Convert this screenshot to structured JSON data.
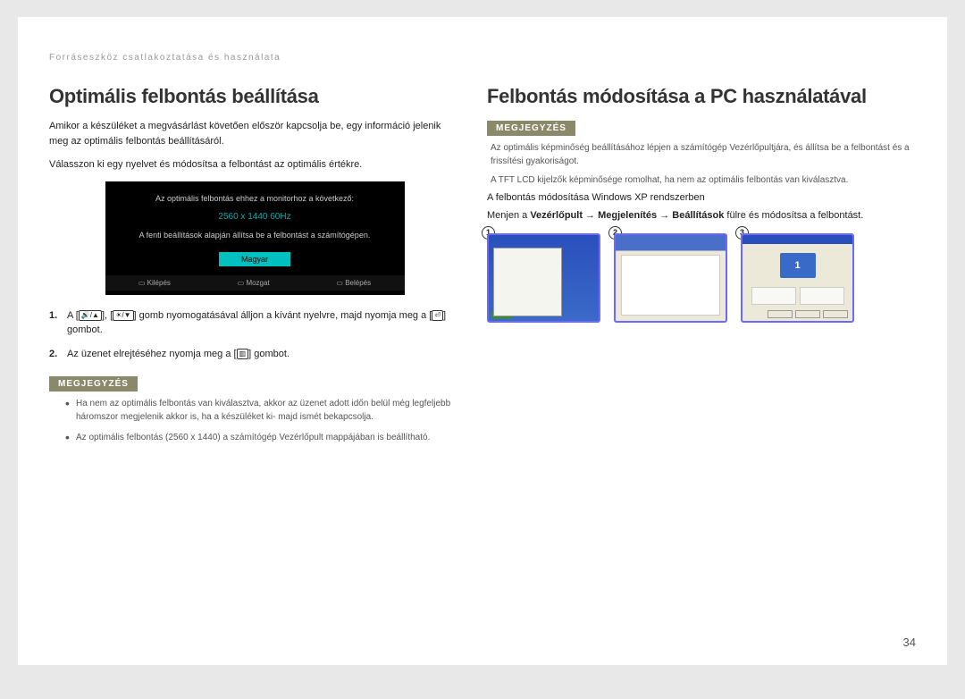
{
  "header": {
    "breadcrumb": "Forráseszköz csatlakoztatása és használata"
  },
  "left": {
    "heading": "Optimális felbontás beállítása",
    "p1": "Amikor a készüléket a megvásárlást követően először kapcsolja be, egy információ jelenik meg az optimális felbontás beállításáról.",
    "p2": "Válasszon ki egy nyelvet és módosítsa a felbontást az optimális értékre.",
    "osd": {
      "line1": "Az optimális felbontás ehhez a monitorhoz a következő:",
      "resolution": "2560 x 1440 60Hz",
      "line2": "A fenti beállítások alapján állítsa be a felbontást a számítógépen.",
      "lang": "Magyar",
      "btn_exit": "Kilépés",
      "btn_move": "Mozgat",
      "btn_enter": "Belépés"
    },
    "step1_a": "A [",
    "step1_b": "], [",
    "step1_c": "] gomb nyomogatásával álljon a kívánt nyelvre, majd nyomja meg a [",
    "step1_d": "] gombot.",
    "step2_a": "Az üzenet elrejtéséhez nyomja meg a [",
    "step2_b": "] gombot.",
    "note_label": "MEGJEGYZÉS",
    "note1": "Ha nem az optimális felbontás van kiválasztva, akkor az üzenet adott időn belül még legfeljebb háromszor megjelenik akkor is, ha a készüléket ki- majd ismét bekapcsolja.",
    "note2": "Az optimális felbontás (2560 x 1440) a számítógép Vezérlőpult mappájában is beállítható."
  },
  "right": {
    "heading": "Felbontás módosítása a PC használatával",
    "note_label": "MEGJEGYZÉS",
    "n1": "Az optimális képminőség beállításához lépjen a számítógép Vezérlőpultjára, és állítsa be a felbontást és a frissítési gyakoriságot.",
    "n2": "A TFT LCD kijelzők képminősége romolhat, ha nem az optimális felbontás van kiválasztva.",
    "sub": "A felbontás módosítása Windows XP rendszerben",
    "nav_a": "Menjen a ",
    "nav_b": "Vezérlőpult",
    "nav_c": " → ",
    "nav_d": "Megjelenítés",
    "nav_e": " → ",
    "nav_f": "Beállítások",
    "nav_g": " fülre és módosítsa a felbontást.",
    "shot1_num": "1",
    "shot2_num": "2",
    "shot3_num": "3",
    "monitor_label": "1",
    "start": "start"
  },
  "page_number": "34"
}
